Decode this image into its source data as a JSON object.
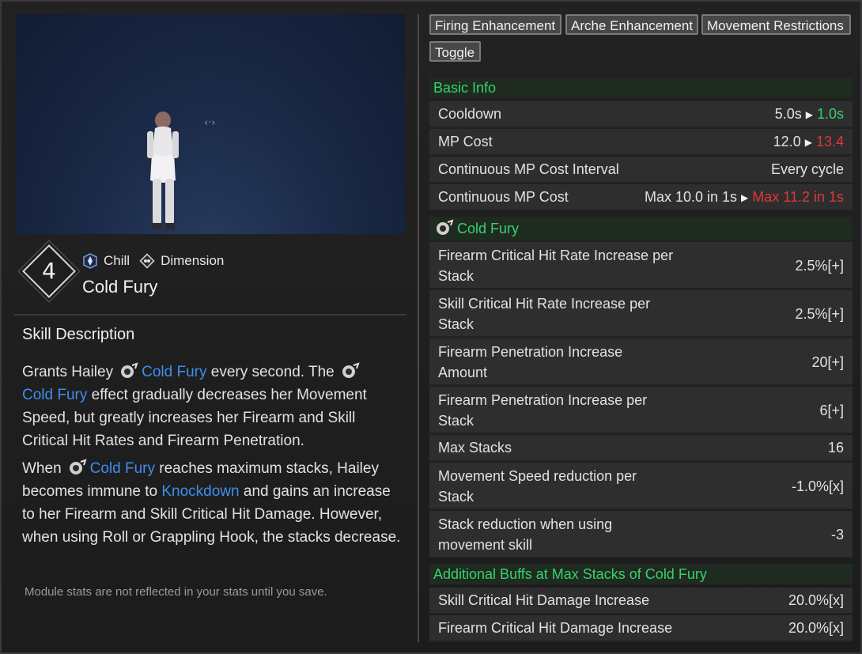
{
  "preview": {
    "resize_hint": "‹·›"
  },
  "skill": {
    "level": "4",
    "tags": [
      {
        "label": "Chill",
        "icon": "chill-element-icon"
      },
      {
        "label": "Dimension",
        "icon": "dimension-icon"
      }
    ],
    "name": "Cold Fury"
  },
  "description": {
    "title": "Skill Description",
    "p1_a": "Grants Hailey",
    "p1_kw1": "Cold Fury",
    "p1_b": "every second. The",
    "p1_kw2": "Cold Fury",
    "p1_c": "effect gradually decreases her Movement Speed, but greatly increases her Firearm and Skill Critical Hit Rates and Firearm Penetration.",
    "p2_a": "When",
    "p2_kw1": "Cold Fury",
    "p2_b": "reaches maximum stacks, Hailey becomes immune to",
    "p2_kw2": "Knockdown",
    "p2_c": "and gains an increase to her Firearm and Skill Critical Hit Damage. However, when using Roll or Grappling Hook, the stacks decrease.",
    "footnote": "Module stats are not reflected in your stats until you save."
  },
  "tabs": [
    "Firing Enhancement",
    "Arche Enhancement",
    "Movement Restrictions",
    "Toggle"
  ],
  "basic_info": {
    "title": "Basic Info",
    "rows": [
      {
        "label": "Cooldown",
        "old": "5.0s",
        "new": "1.0s"
      },
      {
        "label": "MP Cost",
        "old": "12.0",
        "new": "13.4"
      },
      {
        "label": "Continuous MP Cost Interval",
        "value": "Every cycle"
      },
      {
        "label": "Continuous MP Cost",
        "old": "Max 10.0 in 1s",
        "new": "Max 11.2 in 1s"
      }
    ]
  },
  "cold_fury": {
    "title": "Cold Fury",
    "rows": [
      {
        "label1": "Firearm Critical Hit Rate Increase per",
        "label2": "Stack",
        "value": "2.5%[+]"
      },
      {
        "label1": "Skill Critical Hit Rate Increase per",
        "label2": "Stack",
        "value": "2.5%[+]"
      },
      {
        "label1": "Firearm Penetration Increase",
        "label2": "Amount",
        "value": "20[+]"
      },
      {
        "label1": "Firearm Penetration Increase per",
        "label2": "Stack",
        "value": "6[+]"
      },
      {
        "label1": "Max Stacks",
        "label2": "",
        "value": "16"
      },
      {
        "label1": "Movement Speed reduction per",
        "label2": "Stack",
        "value": "-1.0%[x]"
      },
      {
        "label1": "Stack reduction when using",
        "label2": "movement skill",
        "value": "-3"
      }
    ]
  },
  "max_stack_buffs": {
    "title": "Additional Buffs at Max Stacks of Cold Fury",
    "rows": [
      {
        "label": "Skill Critical Hit Damage Increase",
        "value": "20.0%[x]"
      },
      {
        "label": "Firearm Critical Hit Damage Increase",
        "value": "20.0%[x]"
      }
    ]
  },
  "colors": {
    "keyword": "#3d8ef0",
    "improved": "#35d36b",
    "worse": "#e0383a",
    "section": "#35d36b"
  }
}
